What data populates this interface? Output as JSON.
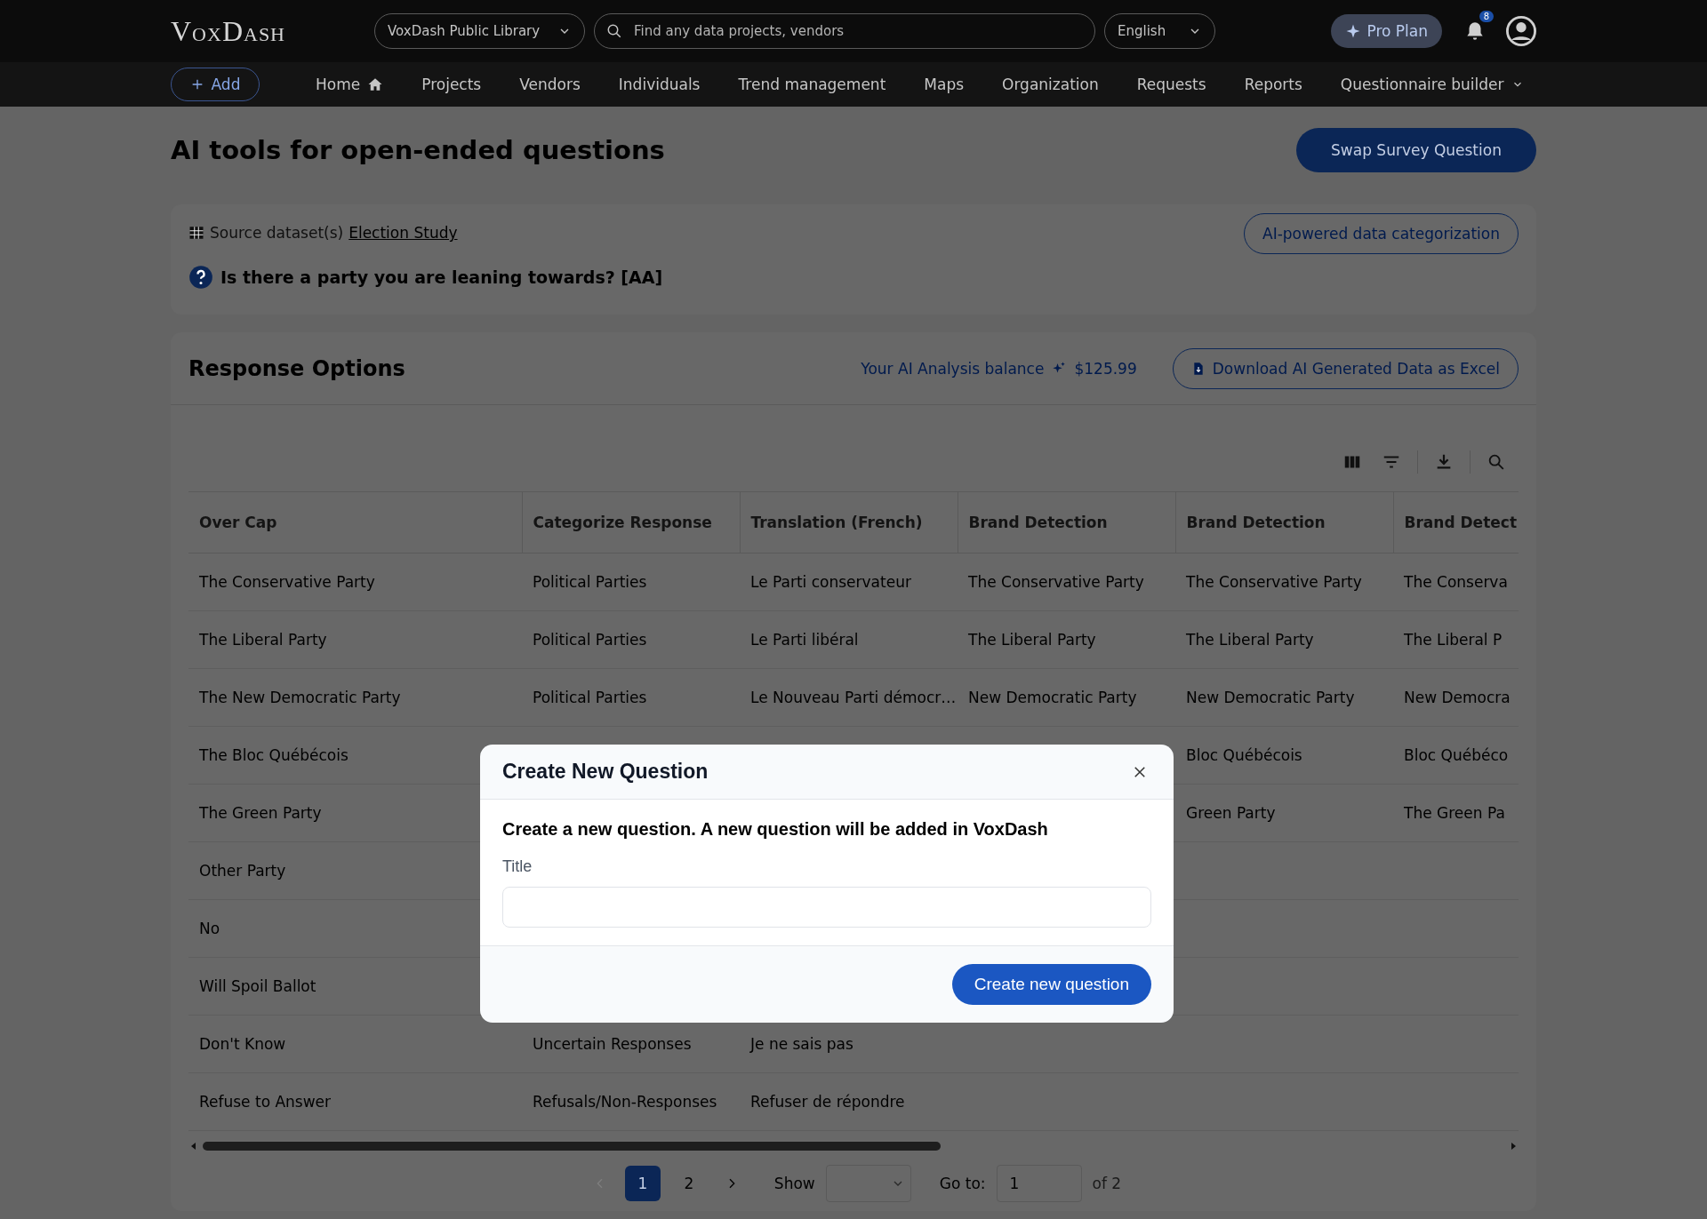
{
  "header": {
    "logo": "VoxDash",
    "library": "VoxDash Public Library",
    "search": {
      "placeholder": "Find any data projects, vendors"
    },
    "language": "English",
    "plan": "Pro Plan",
    "notifications": "8"
  },
  "nav": {
    "add": "Add",
    "items": [
      {
        "label": "Home",
        "kind": "home"
      },
      {
        "label": "Projects",
        "kind": "link"
      },
      {
        "label": "Vendors",
        "kind": "link"
      },
      {
        "label": "Individuals",
        "kind": "link"
      },
      {
        "label": "Trend management",
        "kind": "link"
      },
      {
        "label": "Maps",
        "kind": "link"
      },
      {
        "label": "Organization",
        "kind": "link"
      },
      {
        "label": "Requests",
        "kind": "link"
      },
      {
        "label": "Reports",
        "kind": "link"
      },
      {
        "label": "Questionnaire builder",
        "kind": "dropdown"
      }
    ]
  },
  "page": {
    "title": "AI tools for open-ended questions",
    "swap_button": "Swap Survey Question"
  },
  "source": {
    "label": "Source dataset(s)",
    "dataset": "Election Study",
    "categorize_button": "AI-powered data categorization",
    "question": "Is there a party you are leaning towards? [AA]"
  },
  "responses": {
    "title": "Response Options",
    "balance_label": "Your AI Analysis balance",
    "balance": "$125.99",
    "download_button": "Download AI Generated Data as Excel"
  },
  "table": {
    "columns": [
      "Over Cap",
      "Categorize Response",
      "Translation (French)",
      "Brand Detection",
      "Brand Detection",
      "Brand Detect"
    ],
    "rows": [
      {
        "cells": [
          "The Conservative Party",
          "Political Parties",
          "Le Parti conservateur",
          "The Conservative Party",
          "The Conservative Party",
          "The Conserva"
        ]
      },
      {
        "cells": [
          "The Liberal Party",
          "Political Parties",
          "Le Parti libéral",
          "The Liberal Party",
          "The Liberal Party",
          "The Liberal P"
        ]
      },
      {
        "cells": [
          "The New Democratic Party",
          "Political Parties",
          "Le Nouveau Parti démocr…",
          "New Democratic Party",
          "New Democratic Party",
          "New Democra"
        ]
      },
      {
        "cells": [
          "The Bloc Québécois",
          null,
          null,
          null,
          "Bloc Québécois",
          "Bloc Québéco"
        ]
      },
      {
        "cells": [
          "The Green Party",
          null,
          null,
          null,
          "Green Party",
          "The Green Pa"
        ]
      },
      {
        "cells": [
          "Other Party",
          null,
          null,
          null,
          null,
          null
        ]
      },
      {
        "cells": [
          "No",
          null,
          null,
          null,
          null,
          null
        ]
      },
      {
        "cells": [
          "Will Spoil Ballot",
          null,
          null,
          null,
          null,
          null
        ]
      },
      {
        "cells": [
          "Don't Know",
          "Uncertain Responses",
          "Je ne sais pas",
          null,
          null,
          null
        ]
      },
      {
        "cells": [
          "Refuse to Answer",
          "Refusals/Non-Responses",
          "Refuser de répondre",
          null,
          null,
          null
        ]
      }
    ]
  },
  "pagination": {
    "pages": [
      {
        "label": "1",
        "selected": true
      },
      {
        "label": "2",
        "selected": false
      }
    ],
    "prev_disabled": true,
    "show_label": "Show",
    "goto_label": "Go to:",
    "goto_value": "1",
    "total": "of 2"
  },
  "modal": {
    "title": "Create New Question",
    "message": "Create a new question. A new question will be added in VoxDash",
    "field_label": "Title",
    "submit": "Create new question"
  }
}
